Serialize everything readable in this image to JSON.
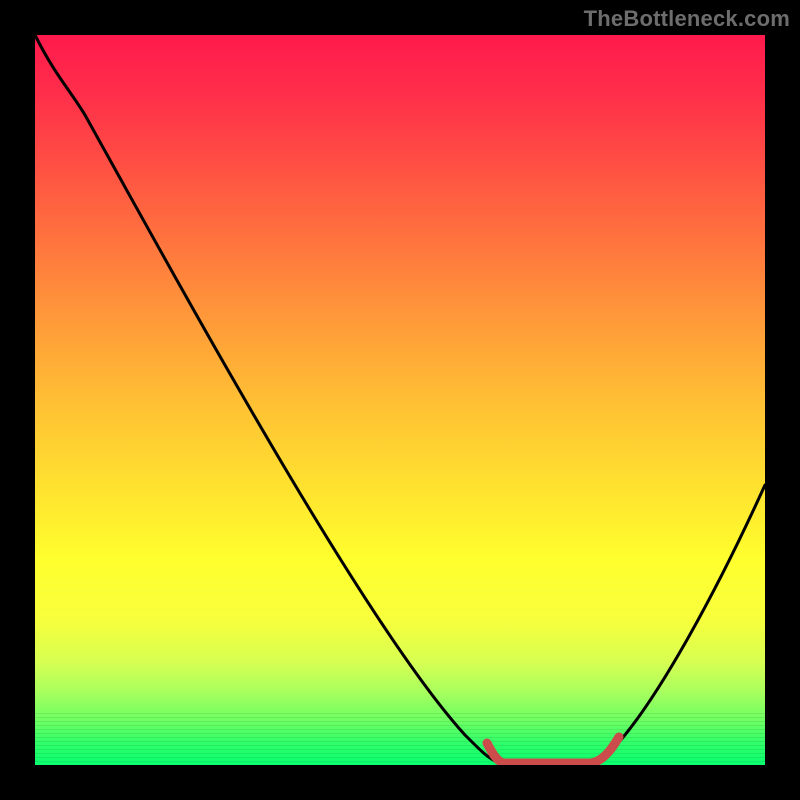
{
  "watermark": "TheBottleneck.com",
  "chart_data": {
    "type": "line",
    "title": "",
    "xlabel": "",
    "ylabel": "",
    "xlim": [
      0,
      100
    ],
    "ylim": [
      0,
      100
    ],
    "series": [
      {
        "name": "bottleneck-curve",
        "x": [
          0,
          4,
          10,
          20,
          30,
          40,
          50,
          58,
          62,
          66,
          72,
          76,
          80,
          86,
          92,
          100
        ],
        "values": [
          100,
          96,
          88,
          74,
          60,
          46,
          32,
          18,
          10,
          4,
          0,
          0,
          0,
          8,
          18,
          38
        ]
      }
    ],
    "flat_region": {
      "x_start": 62,
      "x_end": 80,
      "value": 0
    },
    "colors": {
      "curve": "#000000",
      "flat_highlight": "#cc4b4b",
      "gradient_top": "#ff1a4d",
      "gradient_bottom": "#0aff6e",
      "frame": "#000000"
    }
  }
}
